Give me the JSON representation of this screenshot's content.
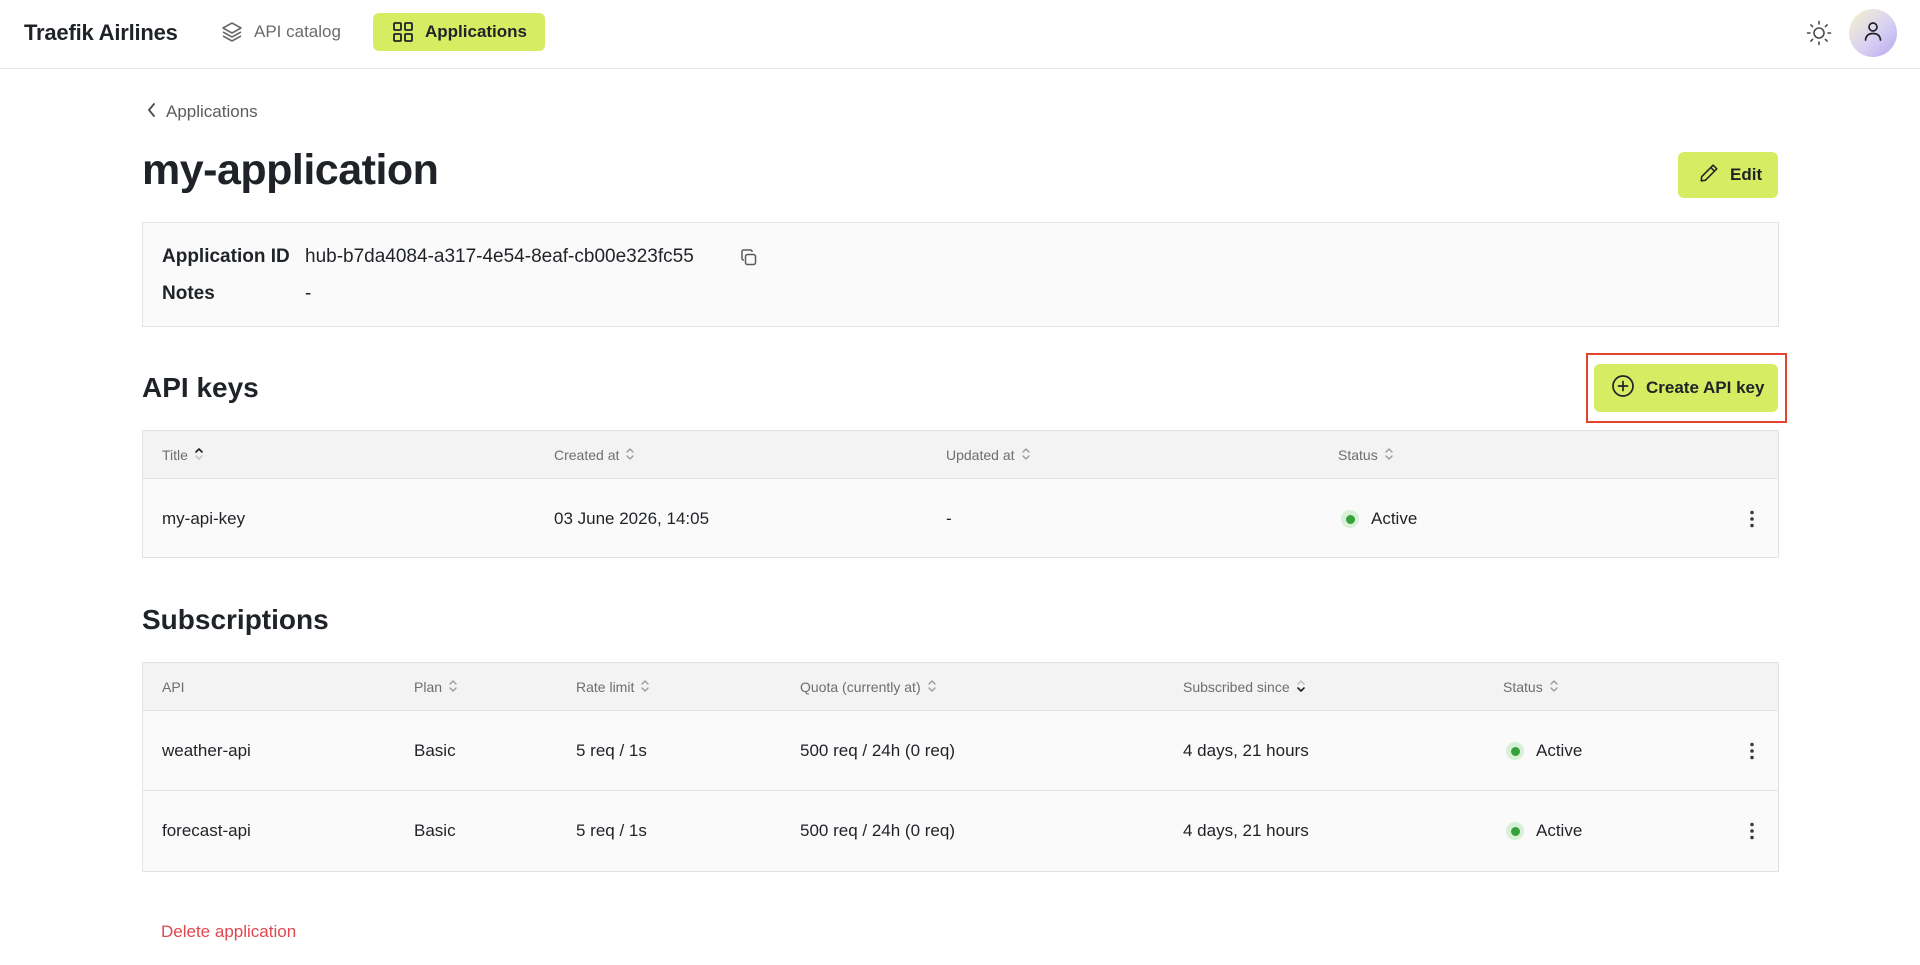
{
  "nav": {
    "brand": "Traefik Airlines",
    "items": [
      {
        "label": "API catalog",
        "icon": "layers-icon",
        "active": false
      },
      {
        "label": "Applications",
        "icon": "grid-icon",
        "active": true
      }
    ]
  },
  "breadcrumb": {
    "label": "Applications"
  },
  "page": {
    "title": "my-application",
    "edit_label": "Edit"
  },
  "info": {
    "app_id_label": "Application ID",
    "app_id_value": "hub-b7da4084-a317-4e54-8eaf-cb00e323fc55",
    "notes_label": "Notes",
    "notes_value": "-"
  },
  "api_keys": {
    "title": "API keys",
    "create_label": "Create API key",
    "columns": [
      "Title",
      "Created at",
      "Updated at",
      "Status"
    ],
    "rows": [
      {
        "title": "my-api-key",
        "created": "03 June 2026, 14:05",
        "updated": "-",
        "status": "Active"
      }
    ]
  },
  "subscriptions": {
    "title": "Subscriptions",
    "columns": [
      "API",
      "Plan",
      "Rate limit",
      "Quota (currently at)",
      "Subscribed since",
      "Status"
    ],
    "rows": [
      {
        "api": "weather-api",
        "plan": "Basic",
        "rate": "5 req / 1s",
        "quota": "500 req / 24h (0 req)",
        "since": "4 days, 21 hours",
        "status": "Active"
      },
      {
        "api": "forecast-api",
        "plan": "Basic",
        "rate": "5 req / 1s",
        "quota": "500 req / 24h (0 req)",
        "since": "4 days, 21 hours",
        "status": "Active"
      }
    ]
  },
  "delete_label": "Delete application",
  "colors": {
    "accent": "#d6ec63",
    "status_active": "#36a33a",
    "danger": "#e0474f",
    "highlight": "#e5452c"
  }
}
